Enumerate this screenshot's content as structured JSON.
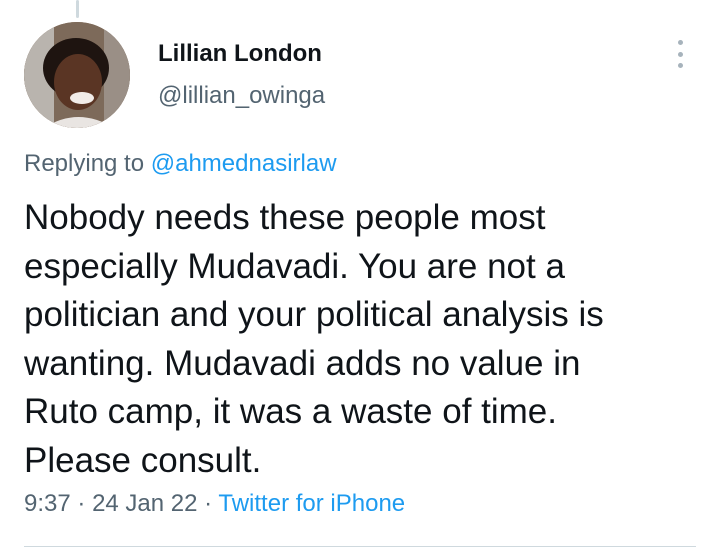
{
  "author": {
    "display_name": "Lillian London",
    "handle": "@lillian_owinga",
    "avatar_icon": "profile-photo"
  },
  "reply": {
    "prefix": "Replying to",
    "mention": "@ahmednasirlaw"
  },
  "tweet": {
    "lines": [
      "Nobody needs these people most",
      "especially Mudavadi. You are not a",
      "politician and your political analysis is",
      "wanting. Mudavadi adds no value in",
      "Ruto camp, it was a waste of time.",
      "Please consult."
    ]
  },
  "meta": {
    "time": "9:37",
    "separator": "·",
    "date": "24 Jan 22",
    "source": "Twitter for iPhone"
  },
  "colors": {
    "text": "#0f1419",
    "secondary": "#536471",
    "link": "#1d9bf0",
    "divider": "#cfd9de"
  }
}
